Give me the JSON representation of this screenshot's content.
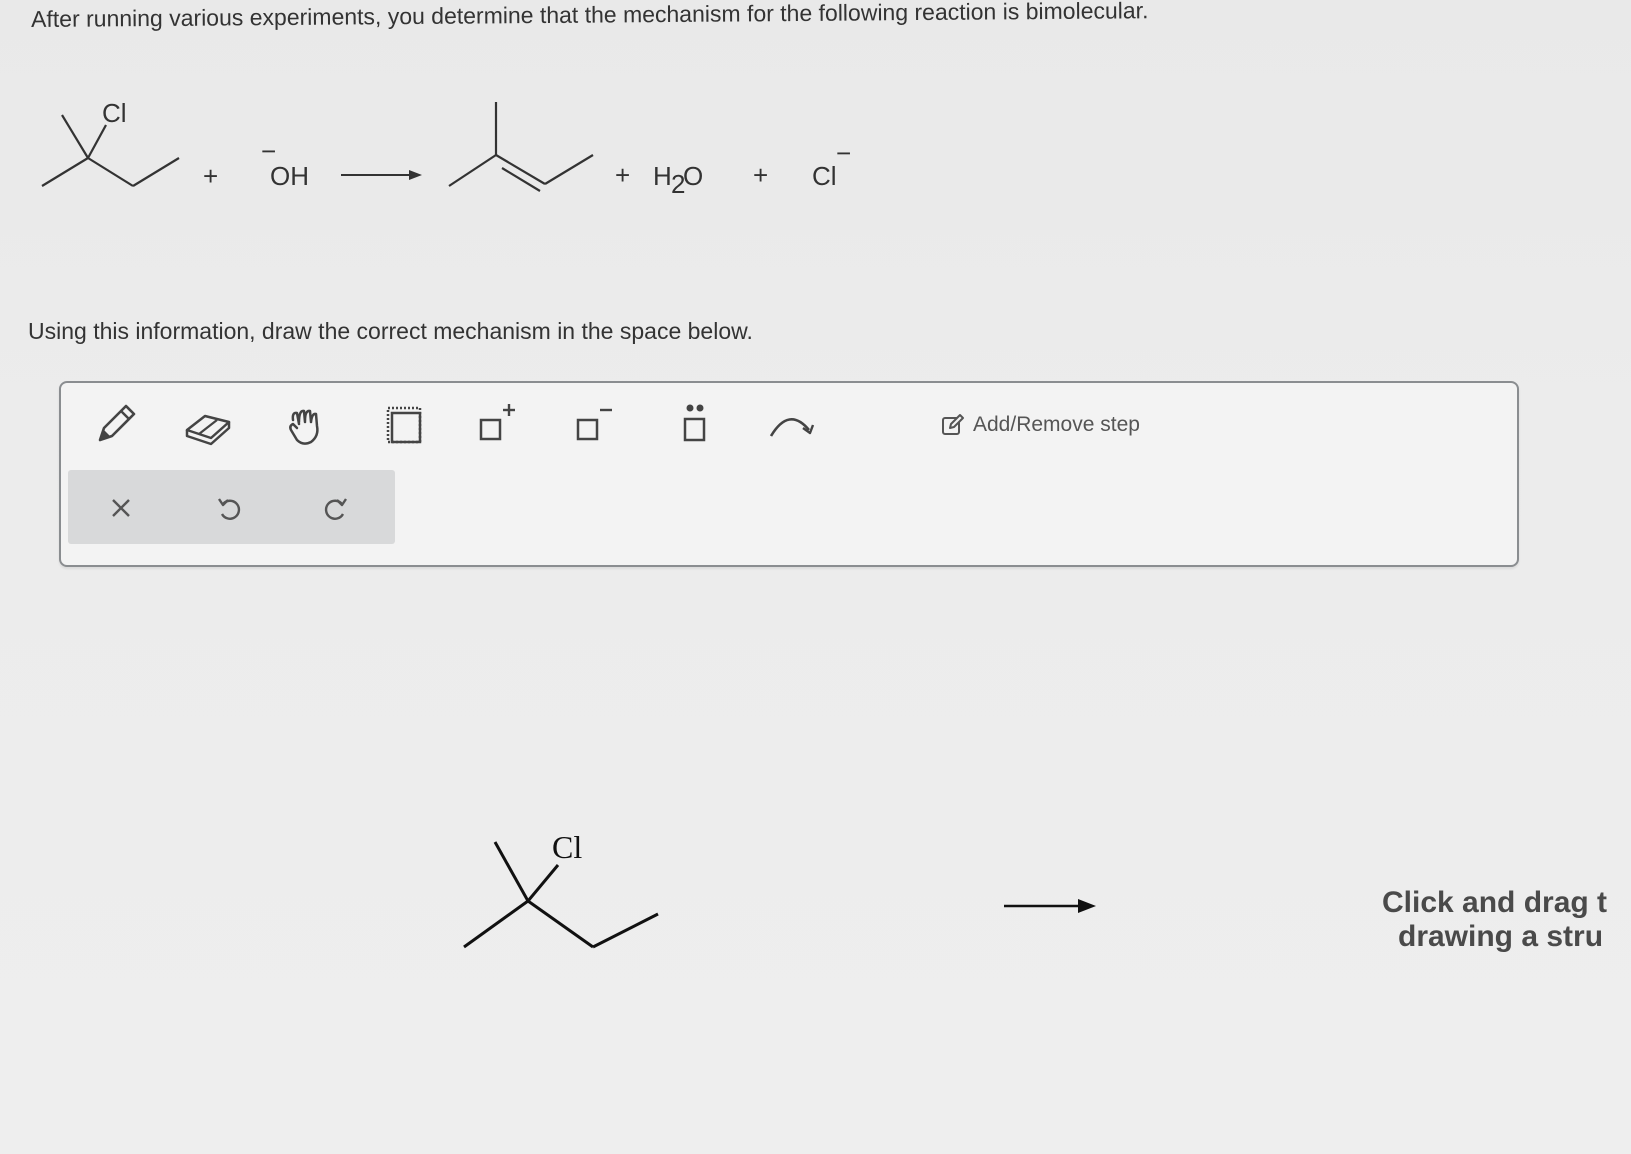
{
  "question": {
    "line1": "After running various experiments, you determine that the mechanism for the following reaction is bimolecular.",
    "line2": "Using this information, draw the correct mechanism in the space below."
  },
  "reaction": {
    "reactant_label": "Cl",
    "plus1": "+",
    "hydroxide_charge": "−",
    "hydroxide": "OH",
    "plus2": "+",
    "water_h": "H",
    "water_sub": "2",
    "water_o": "O",
    "plus3": "+",
    "chloride": "Cl",
    "chloride_charge": "−"
  },
  "toolbar": {
    "tools": [
      {
        "name": "pencil-icon"
      },
      {
        "name": "eraser-icon"
      },
      {
        "name": "hand-icon"
      },
      {
        "name": "select-box-icon"
      },
      {
        "name": "positive-charge-icon"
      },
      {
        "name": "negative-charge-icon"
      },
      {
        "name": "lone-pair-icon"
      },
      {
        "name": "curved-arrow-icon"
      }
    ],
    "add_remove_step": "Add/Remove step",
    "sub_actions": [
      "clear-icon",
      "undo-icon",
      "redo-icon"
    ]
  },
  "canvas": {
    "molecule_label": "Cl",
    "hint_line1": "Click and drag t",
    "hint_line2": "drawing a stru"
  }
}
